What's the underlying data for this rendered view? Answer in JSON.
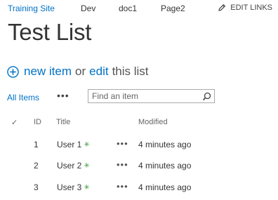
{
  "topnav": {
    "items": [
      "Training Site",
      "Dev",
      "doc1",
      "Page2"
    ],
    "edit_links": "EDIT LINKS"
  },
  "page": {
    "title": "Test List"
  },
  "actions": {
    "new_item": "new item",
    "or": "or",
    "edit": "edit",
    "this_list": "this list"
  },
  "views": {
    "current": "All Items",
    "more": "•••",
    "search_placeholder": "Find an item"
  },
  "list": {
    "columns": [
      "✓",
      "ID",
      "Title",
      "Modified"
    ],
    "rows": [
      {
        "id": "1",
        "title": "User 1",
        "new_marker": "✳",
        "actions": "•••",
        "modified": "4 minutes ago"
      },
      {
        "id": "2",
        "title": "User 2",
        "new_marker": "✳",
        "actions": "•••",
        "modified": "4 minutes ago"
      },
      {
        "id": "3",
        "title": "User 3",
        "new_marker": "✳",
        "actions": "•••",
        "modified": "4 minutes ago"
      }
    ]
  },
  "colors": {
    "link": "#0072c6",
    "new_marker": "#3a9a3a"
  },
  "icons": {
    "edit": "pencil-icon",
    "add": "plus-circle-icon",
    "search": "search-icon"
  }
}
